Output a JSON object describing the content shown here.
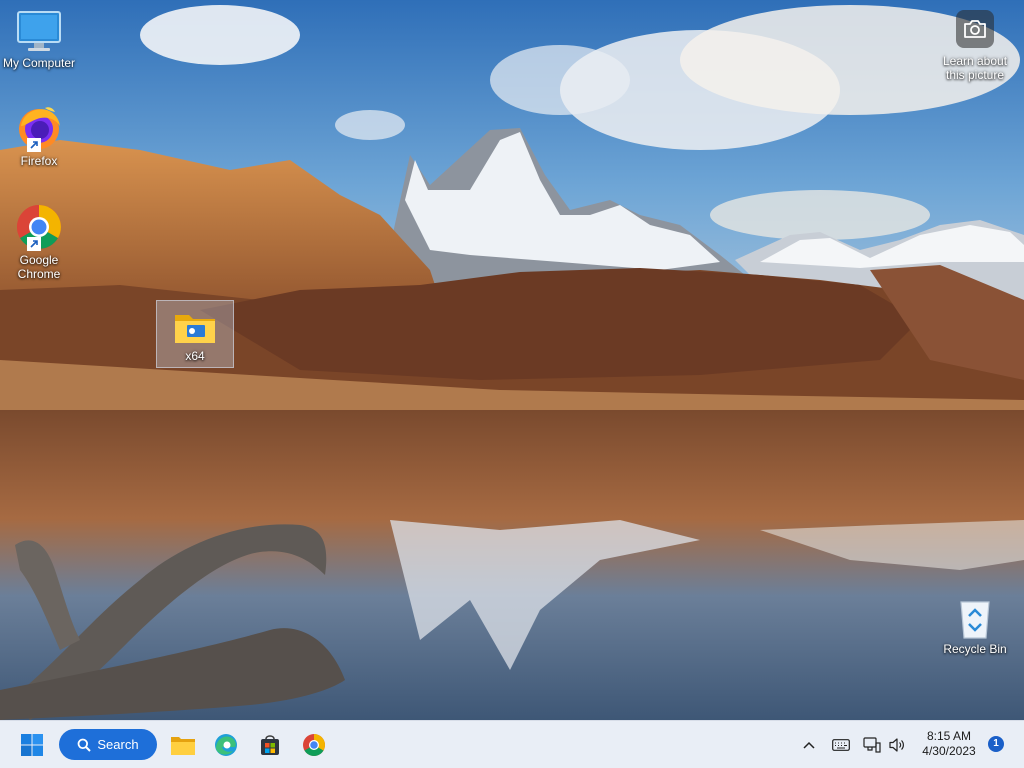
{
  "desktop": {
    "icons": [
      {
        "label": "My Computer"
      },
      {
        "label": "Firefox"
      },
      {
        "label": "Google Chrome"
      },
      {
        "label": "x64"
      },
      {
        "label": "Recycle Bin"
      }
    ],
    "spotlight": {
      "label": "Learn about this picture",
      "icon": "camera-icon"
    }
  },
  "taskbar": {
    "start_icon": "windows-logo-icon",
    "search_label": "Search",
    "pinned": [
      {
        "name": "File Explorer",
        "icon": "folder-icon"
      },
      {
        "name": "Microsoft Edge",
        "icon": "edge-icon"
      },
      {
        "name": "Microsoft Store",
        "icon": "store-icon"
      },
      {
        "name": "Google Chrome",
        "icon": "chrome-icon"
      }
    ],
    "tray": {
      "icons": [
        "chevron-up-icon",
        "keyboard-icon",
        "network-icon",
        "volume-icon"
      ],
      "time": "8:15 AM",
      "date": "4/30/2023",
      "notification_count": "1"
    },
    "accent": "#1e6fd9"
  }
}
